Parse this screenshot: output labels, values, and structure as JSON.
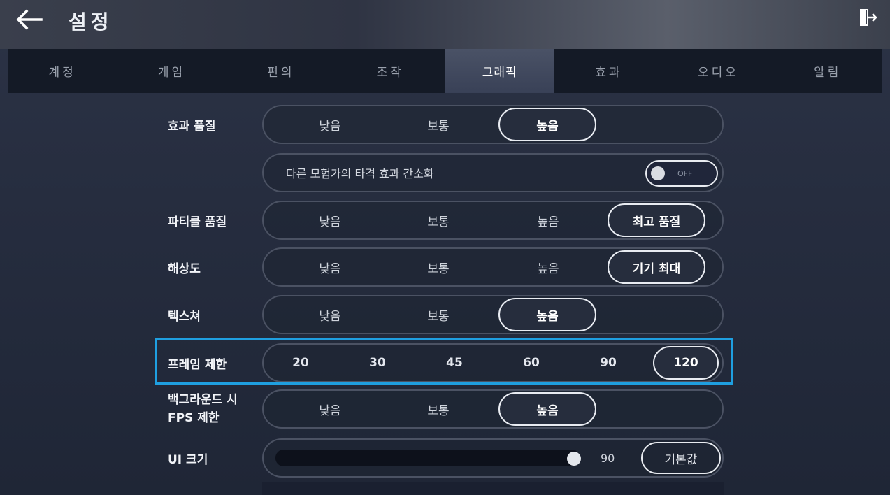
{
  "header": {
    "title": "설정",
    "back_icon": "arrow-left-icon",
    "exit_icon": "exit-door-icon"
  },
  "tabs": [
    {
      "label": "계정",
      "active": false
    },
    {
      "label": "게임",
      "active": false
    },
    {
      "label": "편의",
      "active": false
    },
    {
      "label": "조작",
      "active": false
    },
    {
      "label": "그래픽",
      "active": true
    },
    {
      "label": "효과",
      "active": false
    },
    {
      "label": "오디오",
      "active": false
    },
    {
      "label": "알림",
      "active": false
    }
  ],
  "settings": {
    "effect_quality": {
      "label": "효과 품질",
      "options": [
        "낮음",
        "보통",
        "높음"
      ],
      "selected": "높음"
    },
    "simplify_hit": {
      "label": "다른 모험가의 타격 효과 간소화",
      "state": "OFF"
    },
    "particle_quality": {
      "label": "파티클 품질",
      "options": [
        "낮음",
        "보통",
        "높음",
        "최고 품질"
      ],
      "selected": "최고 품질"
    },
    "resolution": {
      "label": "해상도",
      "options": [
        "낮음",
        "보통",
        "높음",
        "기기 최대"
      ],
      "selected": "기기 최대"
    },
    "texture": {
      "label": "텍스쳐",
      "options": [
        "낮음",
        "보통",
        "높음"
      ],
      "selected": "높음"
    },
    "frame_limit": {
      "label": "프레임 제한",
      "options": [
        "20",
        "30",
        "45",
        "60",
        "90",
        "120"
      ],
      "selected": "120"
    },
    "background_fps": {
      "label_line1": "백그라운드 시",
      "label_line2": "FPS 제한",
      "options": [
        "낮음",
        "보통",
        "높음"
      ],
      "selected": "높음"
    },
    "ui_size": {
      "label": "UI 크기",
      "value": "90",
      "fill_fraction": 0.98,
      "default_label": "기본값"
    }
  },
  "colors": {
    "highlight": "#1f9fe0",
    "background": "#262d3f",
    "tab_bar": "#141a26"
  }
}
